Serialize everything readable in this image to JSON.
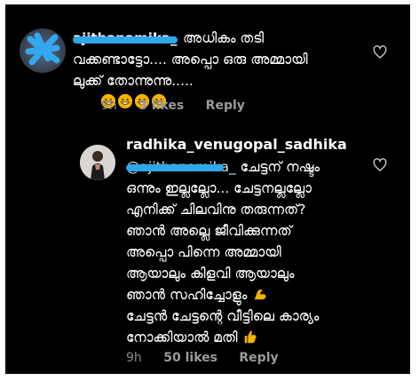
{
  "comments": [
    {
      "username": "ajithanamika_",
      "lines": [
        "അധികം തടി",
        "വക്കണ്ടാട്ടോ.... അപ്പൊ ഒരു അമ്മായി",
        "ലുക്ക് തോന്നുന്നു....."
      ],
      "emoji_icons": [
        "grinning-face-icon",
        "grinning-face-icon",
        "grinning-face-icon",
        "grinning-face-icon"
      ],
      "time": "9h",
      "likes": "3 likes",
      "reply_label": "Reply"
    },
    {
      "username": "radhika_venugopal_sadhika",
      "mention": "@ajithanamika_",
      "lines": [
        "ചേട്ടന് നഷ്ടം",
        "ഒന്നും ഇല്ലല്ലോ... ചേട്ടനല്ലല്ലോ",
        "എനിക്ക് ചിലവിനു തരുന്നത്?",
        "ഞാൻ അല്ലെ ജീവിക്കുന്നത്",
        "അപ്പൊ പിന്നെ അമ്മായി",
        "ആയാലും കിളവി ആയാലും",
        "ഞാൻ സഹിച്ചോളും",
        "ചേട്ടൻ ചേട്ടന്റെ വീട്ടിലെ കാര്യം",
        "നോക്കിയാൽ മതി"
      ],
      "line7_icon": "flexed-biceps-icon",
      "line9_icon": "thumbs-up-icon",
      "time": "9h",
      "likes": "50 likes",
      "reply_label": "Reply"
    }
  ],
  "colors": {
    "background": "#000000",
    "text": "#ffffff",
    "meta": "#8a8a8a",
    "redaction": "#2fa7e8",
    "emoji": "#f5b400"
  }
}
